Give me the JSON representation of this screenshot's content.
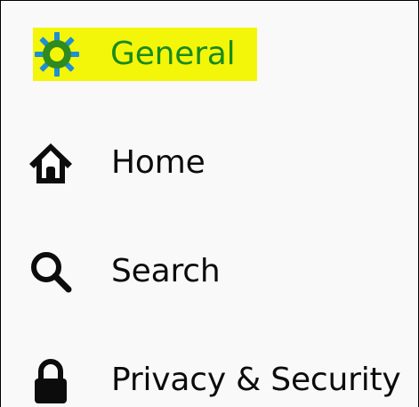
{
  "sidebar": {
    "items": [
      {
        "label": "General",
        "icon": "gear-icon",
        "selected": true
      },
      {
        "label": "Home",
        "icon": "home-icon",
        "selected": false
      },
      {
        "label": "Search",
        "icon": "search-icon",
        "selected": false
      },
      {
        "label": "Privacy & Security",
        "icon": "lock-icon",
        "selected": false
      }
    ]
  },
  "colors": {
    "highlight": "#f4f60a",
    "selected_text": "#1a8a1e",
    "gear_outer": "#1e8fd6",
    "gear_inner": "#2e8b1f",
    "text": "#0c0c0d",
    "background": "#f9f9fa"
  }
}
